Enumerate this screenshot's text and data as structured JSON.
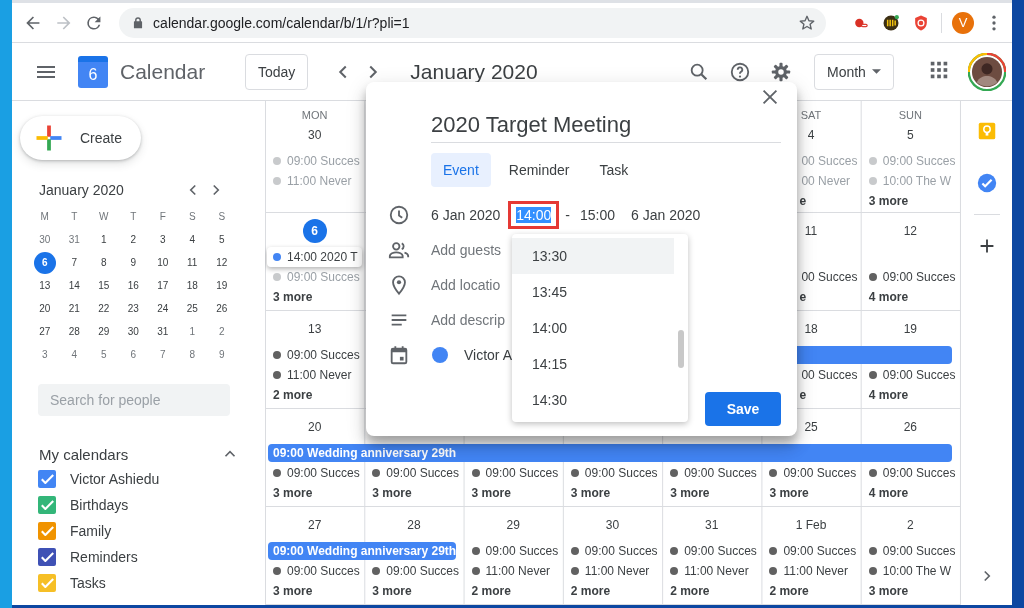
{
  "browser": {
    "url": "calendar.google.com/calendar/b/1/r?pli=1",
    "profile_initial": "V"
  },
  "header": {
    "logo_day": "6",
    "app_name": "Calendar",
    "today_button": "Today",
    "period": "January 2020",
    "view_button": "Month"
  },
  "sidebar": {
    "create_button": "Create",
    "mini_calendar": {
      "title": "January 2020",
      "weekdays": [
        "M",
        "T",
        "W",
        "T",
        "F",
        "S",
        "S"
      ],
      "weeks": [
        [
          {
            "label": "30",
            "muted": true,
            "selected": false
          },
          {
            "label": "31",
            "muted": true,
            "selected": false
          },
          {
            "label": "1",
            "muted": false,
            "selected": false
          },
          {
            "label": "2",
            "muted": false,
            "selected": false
          },
          {
            "label": "3",
            "muted": false,
            "selected": false
          },
          {
            "label": "4",
            "muted": false,
            "selected": false
          },
          {
            "label": "5",
            "muted": false,
            "selected": false
          }
        ],
        [
          {
            "label": "6",
            "muted": false,
            "selected": true
          },
          {
            "label": "7",
            "muted": false,
            "selected": false
          },
          {
            "label": "8",
            "muted": false,
            "selected": false
          },
          {
            "label": "9",
            "muted": false,
            "selected": false
          },
          {
            "label": "10",
            "muted": false,
            "selected": false
          },
          {
            "label": "11",
            "muted": false,
            "selected": false
          },
          {
            "label": "12",
            "muted": false,
            "selected": false
          }
        ],
        [
          {
            "label": "13",
            "muted": false,
            "selected": false
          },
          {
            "label": "14",
            "muted": false,
            "selected": false
          },
          {
            "label": "15",
            "muted": false,
            "selected": false
          },
          {
            "label": "16",
            "muted": false,
            "selected": false
          },
          {
            "label": "17",
            "muted": false,
            "selected": false
          },
          {
            "label": "18",
            "muted": false,
            "selected": false
          },
          {
            "label": "19",
            "muted": false,
            "selected": false
          }
        ],
        [
          {
            "label": "20",
            "muted": false,
            "selected": false
          },
          {
            "label": "21",
            "muted": false,
            "selected": false
          },
          {
            "label": "22",
            "muted": false,
            "selected": false
          },
          {
            "label": "23",
            "muted": false,
            "selected": false
          },
          {
            "label": "24",
            "muted": false,
            "selected": false
          },
          {
            "label": "25",
            "muted": false,
            "selected": false
          },
          {
            "label": "26",
            "muted": false,
            "selected": false
          }
        ],
        [
          {
            "label": "27",
            "muted": false,
            "selected": false
          },
          {
            "label": "28",
            "muted": false,
            "selected": false
          },
          {
            "label": "29",
            "muted": false,
            "selected": false
          },
          {
            "label": "30",
            "muted": false,
            "selected": false
          },
          {
            "label": "31",
            "muted": false,
            "selected": false
          },
          {
            "label": "1",
            "muted": true,
            "selected": false
          },
          {
            "label": "2",
            "muted": true,
            "selected": false
          }
        ],
        [
          {
            "label": "3",
            "muted": true,
            "selected": false
          },
          {
            "label": "4",
            "muted": true,
            "selected": false
          },
          {
            "label": "5",
            "muted": true,
            "selected": false
          },
          {
            "label": "6",
            "muted": true,
            "selected": false
          },
          {
            "label": "7",
            "muted": true,
            "selected": false
          },
          {
            "label": "8",
            "muted": true,
            "selected": false
          },
          {
            "label": "9",
            "muted": true,
            "selected": false
          }
        ]
      ]
    },
    "people_search": {
      "placeholder": "Search for people"
    },
    "my_calendars": {
      "title": "My calendars",
      "expanded": true,
      "items": [
        {
          "label": "Victor Ashiedu",
          "checked": true,
          "color": "#4285f4"
        },
        {
          "label": "Birthdays",
          "checked": true,
          "color": "#33b679"
        },
        {
          "label": "Family",
          "checked": true,
          "color": "#f09300"
        },
        {
          "label": "Reminders",
          "checked": true,
          "color": "#3f51b5"
        },
        {
          "label": "Tasks",
          "checked": true,
          "color": "#f6bf26"
        }
      ]
    }
  },
  "month_grid": {
    "weeks": [
      {
        "days": [
          {
            "weekday": "MON",
            "date": "30",
            "today": false,
            "events": [
              {
                "kind": "event",
                "text": "09:00 Succes",
                "past": true
              },
              {
                "kind": "event",
                "text": "11:00 Never",
                "past": true
              }
            ]
          }
        ],
        "right_days": [
          {
            "weekday": "SAT",
            "date": "4",
            "today": false,
            "partly_hidden": true,
            "events": [
              {
                "kind": "event",
                "text": "00 Succes",
                "past": true
              },
              {
                "kind": "event",
                "text": "00 Never",
                "past": true
              },
              {
                "kind": "more",
                "text": "e"
              }
            ]
          },
          {
            "weekday": "SUN",
            "date": "5",
            "today": false,
            "events": [
              {
                "kind": "event",
                "text": "09:00 Succes",
                "past": true
              },
              {
                "kind": "event",
                "text": "10:00 The W",
                "past": true
              },
              {
                "kind": "more",
                "text": "3 more"
              }
            ]
          }
        ]
      },
      {
        "days": [
          {
            "date": "6",
            "today": true,
            "events": [
              {
                "kind": "draft",
                "text": "14:00 2020 T"
              },
              {
                "kind": "event",
                "text": "09:00 Succes",
                "past": true
              },
              {
                "kind": "more",
                "text": "3 more"
              }
            ]
          }
        ],
        "right_days": [
          {
            "date": "11",
            "today": false,
            "partly_hidden": true,
            "events": [
              {
                "kind": "gap"
              },
              {
                "kind": "event",
                "text": "00 Succes",
                "past": false
              },
              {
                "kind": "more",
                "text": "e"
              }
            ]
          },
          {
            "date": "12",
            "today": false,
            "events": [
              {
                "kind": "gap"
              },
              {
                "kind": "event",
                "text": "09:00 Succes",
                "past": false
              },
              {
                "kind": "more",
                "text": "4 more"
              }
            ]
          }
        ]
      },
      {
        "days": [
          {
            "date": "13",
            "today": false,
            "events": [
              {
                "kind": "event",
                "text": "09:00 Succes",
                "past": false
              },
              {
                "kind": "event",
                "text": "11:00 Never",
                "past": false
              },
              {
                "kind": "more",
                "text": "2 more"
              }
            ]
          }
        ],
        "right_days": [
          {
            "date": "18",
            "today": false,
            "partly_hidden": true,
            "events": [
              {
                "kind": "bar"
              },
              {
                "kind": "event",
                "text": "00 Succes",
                "past": false
              },
              {
                "kind": "more",
                "text": "e"
              }
            ]
          },
          {
            "date": "19",
            "today": false,
            "events": [
              {
                "kind": "bar-continued"
              },
              {
                "kind": "event",
                "text": "09:00 Succes",
                "past": false
              },
              {
                "kind": "more",
                "text": "4 more"
              }
            ]
          }
        ]
      },
      {
        "days": [
          {
            "date": "20",
            "today": false,
            "events": [
              {
                "kind": "bar",
                "text": "09:00 Wedding anniversary 29th"
              },
              {
                "kind": "event",
                "text": "09:00 Succes",
                "past": false
              },
              {
                "kind": "more",
                "text": "3 more"
              }
            ]
          },
          {
            "events": [
              {
                "kind": "bar-continued"
              },
              {
                "kind": "event",
                "text": "09:00 Succes",
                "past": false
              },
              {
                "kind": "more",
                "text": "3 more"
              }
            ]
          },
          {
            "events": [
              {
                "kind": "bar-continued"
              },
              {
                "kind": "event",
                "text": "09:00 Succes",
                "past": false
              },
              {
                "kind": "more",
                "text": "3 more"
              }
            ]
          },
          {
            "events": [
              {
                "kind": "bar-continued"
              },
              {
                "kind": "event",
                "text": "09:00 Succes",
                "past": false
              },
              {
                "kind": "more",
                "text": "3 more"
              }
            ]
          },
          {
            "events": [
              {
                "kind": "bar-continued"
              },
              {
                "kind": "event",
                "text": "09:00 Succes",
                "past": false
              },
              {
                "kind": "more",
                "text": "3 more"
              }
            ]
          },
          {
            "date": "25",
            "today": false,
            "events": [
              {
                "kind": "bar-continued"
              },
              {
                "kind": "event",
                "text": "09:00 Succes",
                "past": false
              },
              {
                "kind": "more",
                "text": "3 more"
              }
            ]
          },
          {
            "date": "26",
            "today": false,
            "events": [
              {
                "kind": "bar-continued"
              },
              {
                "kind": "event",
                "text": "09:00 Succes",
                "past": false
              },
              {
                "kind": "more",
                "text": "4 more"
              }
            ]
          }
        ]
      },
      {
        "days": [
          {
            "date": "27",
            "today": false,
            "events": [
              {
                "kind": "bar",
                "text": "09:00 Wedding anniversary 29th"
              },
              {
                "kind": "event",
                "text": "09:00 Succes",
                "past": false
              },
              {
                "kind": "more",
                "text": "3 more"
              }
            ]
          },
          {
            "date": "28",
            "today": false,
            "events": [
              {
                "kind": "bar-continued"
              },
              {
                "kind": "event",
                "text": "09:00 Succes",
                "past": false
              },
              {
                "kind": "more",
                "text": "3 more"
              }
            ]
          },
          {
            "date": "29",
            "today": false,
            "events": [
              {
                "kind": "event",
                "text": "09:00 Succes",
                "past": false
              },
              {
                "kind": "event",
                "text": "11:00 Never",
                "past": false
              },
              {
                "kind": "more",
                "text": "2 more"
              }
            ]
          },
          {
            "date": "30",
            "today": false,
            "events": [
              {
                "kind": "event",
                "text": "09:00 Succes",
                "past": false
              },
              {
                "kind": "event",
                "text": "11:00 Never",
                "past": false
              },
              {
                "kind": "more",
                "text": "2 more"
              }
            ]
          },
          {
            "date": "31",
            "today": false,
            "events": [
              {
                "kind": "event",
                "text": "09:00 Succes",
                "past": false
              },
              {
                "kind": "event",
                "text": "11:00 Never",
                "past": false
              },
              {
                "kind": "more",
                "text": "2 more"
              }
            ]
          },
          {
            "date": "1 Feb",
            "today": false,
            "events": [
              {
                "kind": "event",
                "text": "09:00 Succes",
                "past": false
              },
              {
                "kind": "event",
                "text": "11:00 Never",
                "past": false
              },
              {
                "kind": "more",
                "text": "2 more"
              }
            ]
          },
          {
            "date": "2",
            "today": false,
            "events": [
              {
                "kind": "event",
                "text": "09:00 Succes",
                "past": false
              },
              {
                "kind": "event",
                "text": "10:00 The W",
                "past": false
              },
              {
                "kind": "more",
                "text": "3 more"
              }
            ]
          }
        ]
      }
    ]
  },
  "dialog": {
    "title": "2020 Target Meeting",
    "tabs": [
      {
        "label": "Event",
        "selected": true
      },
      {
        "label": "Reminder",
        "selected": false
      },
      {
        "label": "Task",
        "selected": false
      }
    ],
    "start_date": "6 Jan 2020",
    "start_time": "14:00",
    "start_time_selected": true,
    "separator": "-",
    "end_time": "15:00",
    "end_date": "6 Jan 2020",
    "guests": {
      "placeholder": "Add guests"
    },
    "location": {
      "placeholder": "Add locatio"
    },
    "description": {
      "placeholder": "Add descrip"
    },
    "calendar": {
      "name": "Victor A",
      "color": "#4285f4"
    },
    "time_options": [
      {
        "label": "13:30",
        "hovered": true
      },
      {
        "label": "13:45",
        "hovered": false
      },
      {
        "label": "14:00",
        "hovered": false
      },
      {
        "label": "14:15",
        "hovered": false
      },
      {
        "label": "14:30",
        "hovered": false
      }
    ],
    "save_button": "Save"
  }
}
